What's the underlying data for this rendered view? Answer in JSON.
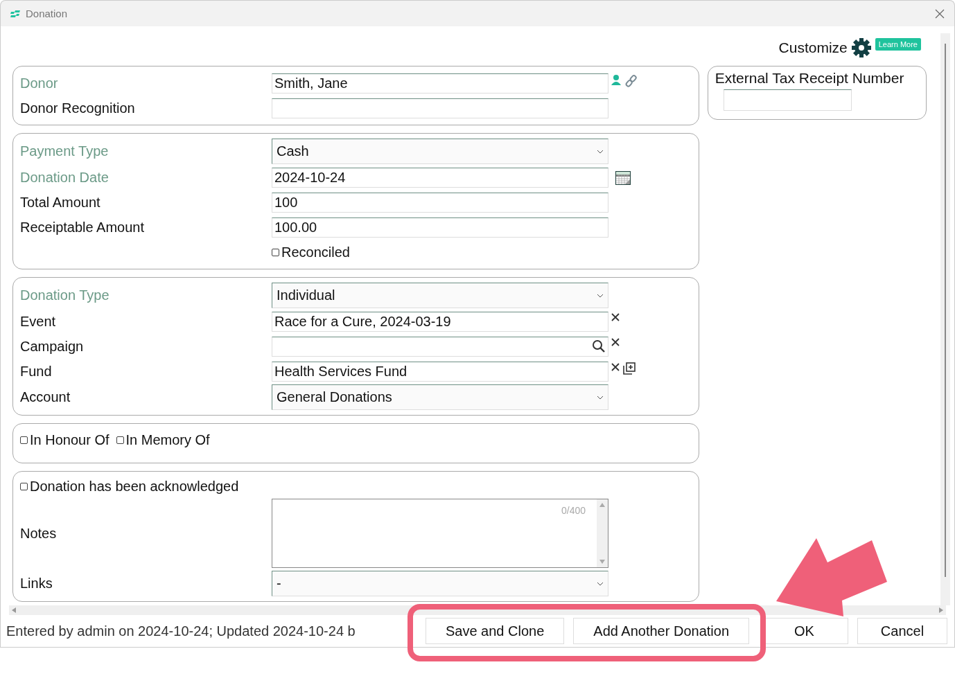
{
  "window": {
    "title": "Donation"
  },
  "customize": {
    "label": "Customize",
    "learn_more": "Learn More"
  },
  "sections": [
    {
      "rows": [
        {
          "kind": "lookup",
          "label": "Donor",
          "required": true,
          "value": "Smith, Jane"
        },
        {
          "kind": "text",
          "label": "Donor Recognition",
          "required": false
        }
      ]
    },
    {
      "rows": [
        {
          "kind": "select",
          "label": "Payment Type",
          "required": true,
          "value": "Cash"
        },
        {
          "kind": "date",
          "label": "Donation Date",
          "required": true,
          "value": "2024-10-24"
        },
        {
          "kind": "text",
          "label": "Total Amount",
          "required": false,
          "value": "100"
        },
        {
          "kind": "text",
          "label": "Receiptable Amount",
          "required": false,
          "value": "100.00"
        },
        {
          "kind": "checkbox",
          "label": "Reconciled",
          "checked": false
        }
      ]
    },
    {
      "rows": [
        {
          "kind": "select",
          "label": "Donation Type",
          "required": true,
          "value": "Individual"
        },
        {
          "kind": "text-clear",
          "label": "Event",
          "required": false,
          "value": "Race for a Cure, 2024-03-19"
        },
        {
          "kind": "search-clear",
          "label": "Campaign",
          "required": false
        },
        {
          "kind": "text-clear-add",
          "label": "Fund",
          "required": false,
          "value": "Health Services Fund"
        },
        {
          "kind": "select",
          "label": "Account",
          "required": false,
          "value": "General Donations"
        }
      ]
    },
    {
      "rows": [
        {
          "kind": "checkboxes",
          "items": [
            {
              "label": "In Honour Of",
              "checked": false
            },
            {
              "label": "In Memory Of",
              "checked": false
            }
          ]
        }
      ]
    },
    {
      "rows": [
        {
          "kind": "wide-checkbox",
          "label": "Donation has been acknowledged",
          "checked": false
        },
        {
          "kind": "textarea",
          "label": "Notes",
          "required": false,
          "counter": "0/400"
        },
        {
          "kind": "select",
          "label": "Links",
          "required": false,
          "value": "-"
        }
      ]
    }
  ],
  "external_tax_receipt": {
    "label": "External Tax Receipt Number"
  },
  "status": "Entered by admin on 2024-10-24; Updated 2024-10-24 b",
  "buttons": [
    "Save and Clone",
    "Add Another Donation",
    "OK",
    "Cancel"
  ]
}
